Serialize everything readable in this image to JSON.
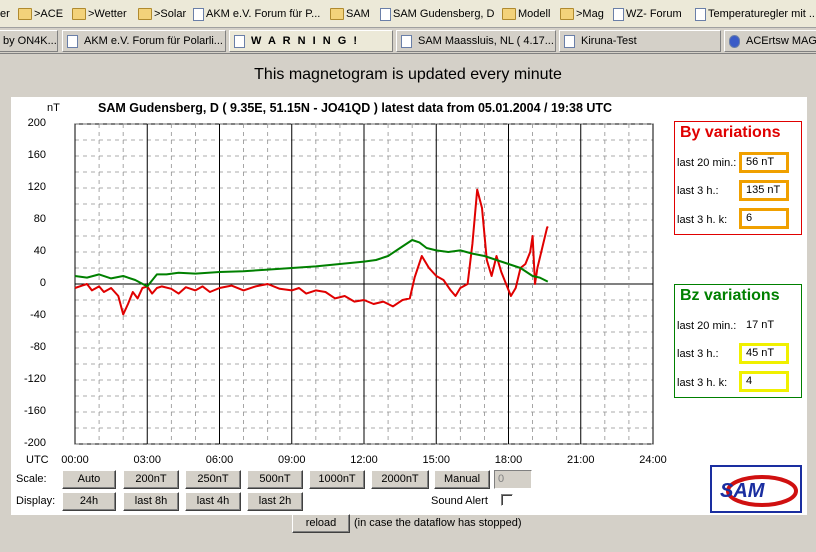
{
  "bookmarks": [
    {
      "label": "er",
      "icon": "none",
      "x": 0
    },
    {
      "label": ">ACE",
      "icon": "folder-icon",
      "x": 18
    },
    {
      "label": ">Wetter",
      "icon": "folder-icon",
      "x": 72
    },
    {
      "label": ">Solar",
      "icon": "folder-icon",
      "x": 138
    },
    {
      "label": "AKM e.V. Forum für P...",
      "icon": "page-icon",
      "x": 193
    },
    {
      "label": "SAM",
      "icon": "folder-icon",
      "x": 330
    },
    {
      "label": "SAM Gudensberg, D",
      "icon": "page-icon",
      "x": 380
    },
    {
      "label": "Modell",
      "icon": "folder-icon",
      "x": 502
    },
    {
      "label": ">Mag",
      "icon": "folder-icon",
      "x": 560
    },
    {
      "label": "WZ- Forum",
      "icon": "page-icon",
      "x": 613
    },
    {
      "label": "Temperaturegler mit ...",
      "icon": "page-icon",
      "x": 695
    }
  ],
  "tabs": [
    {
      "label": "by ON4K..."
    },
    {
      "label": "AKM e.V. Forum für Polarli..."
    },
    {
      "label": "W A R N I N G !"
    },
    {
      "label": "SAM Maassluis, NL ( 4.17..."
    },
    {
      "label": "Kiruna-Test"
    },
    {
      "label": "ACErtsw MAG"
    }
  ],
  "banner": "This magnetogram is updated every minute",
  "chart_data": {
    "type": "line",
    "title": "SAM Gudensberg, D  ( 9.35E, 51.15N - JO41QD )  latest data from 05.01.2004 / 19:38 UTC",
    "ylabel": "nT",
    "xlabel": "UTC",
    "ylim": [
      -200,
      200
    ],
    "xlim": [
      0,
      24
    ],
    "yticks": [
      "200",
      "160",
      "120",
      "80",
      "40",
      "0",
      "-40",
      "-80",
      "-120",
      "-160",
      "-200"
    ],
    "xticks": [
      "00:00",
      "03:00",
      "06:00",
      "09:00",
      "12:00",
      "15:00",
      "18:00",
      "21:00",
      "24:00"
    ],
    "grid": true,
    "series": [
      {
        "name": "By",
        "color": "#e00000",
        "points": [
          [
            0,
            -5
          ],
          [
            0.3,
            -2
          ],
          [
            0.5,
            0
          ],
          [
            0.7,
            -8
          ],
          [
            1,
            -3
          ],
          [
            1.2,
            -10
          ],
          [
            1.5,
            -5
          ],
          [
            1.8,
            -15
          ],
          [
            2,
            -38
          ],
          [
            2.2,
            -25
          ],
          [
            2.4,
            -10
          ],
          [
            2.6,
            -18
          ],
          [
            2.8,
            -5
          ],
          [
            3,
            -3
          ],
          [
            3.2,
            -12
          ],
          [
            3.4,
            -5
          ],
          [
            3.6,
            -3
          ],
          [
            4,
            -6
          ],
          [
            4.3,
            -12
          ],
          [
            4.6,
            -4
          ],
          [
            5,
            -8
          ],
          [
            5.3,
            -3
          ],
          [
            5.6,
            -10
          ],
          [
            6,
            -5
          ],
          [
            6.5,
            -2
          ],
          [
            7,
            -8
          ],
          [
            7.5,
            -3
          ],
          [
            8,
            0
          ],
          [
            8.5,
            -6
          ],
          [
            9,
            -8
          ],
          [
            9.3,
            -5
          ],
          [
            9.6,
            -12
          ],
          [
            10,
            -8
          ],
          [
            10.4,
            -10
          ],
          [
            10.8,
            -18
          ],
          [
            11.2,
            -15
          ],
          [
            11.6,
            -22
          ],
          [
            12,
            -20
          ],
          [
            12.4,
            -25
          ],
          [
            12.8,
            -22
          ],
          [
            13.2,
            -28
          ],
          [
            13.6,
            -20
          ],
          [
            13.9,
            -18
          ],
          [
            14.1,
            8
          ],
          [
            14.4,
            35
          ],
          [
            14.7,
            20
          ],
          [
            15,
            10
          ],
          [
            15.3,
            5
          ],
          [
            15.6,
            -8
          ],
          [
            15.8,
            -15
          ],
          [
            16.0,
            -5
          ],
          [
            16.3,
            0
          ],
          [
            16.5,
            50
          ],
          [
            16.7,
            118
          ],
          [
            16.9,
            95
          ],
          [
            17.1,
            30
          ],
          [
            17.3,
            10
          ],
          [
            17.5,
            35
          ],
          [
            17.7,
            15
          ],
          [
            17.9,
            0
          ],
          [
            18.1,
            -15
          ],
          [
            18.3,
            -5
          ],
          [
            18.5,
            20
          ],
          [
            18.7,
            25
          ],
          [
            18.9,
            40
          ],
          [
            19.0,
            60
          ],
          [
            19.1,
            0
          ],
          [
            19.2,
            20
          ],
          [
            19.4,
            45
          ],
          [
            19.6,
            70
          ],
          [
            19.63,
            72
          ]
        ]
      },
      {
        "name": "Bz",
        "color": "#008000",
        "points": [
          [
            0,
            10
          ],
          [
            0.5,
            8
          ],
          [
            1,
            12
          ],
          [
            1.5,
            7
          ],
          [
            2,
            10
          ],
          [
            2.5,
            5
          ],
          [
            3,
            -3
          ],
          [
            3.4,
            12
          ],
          [
            3.8,
            12
          ],
          [
            4.3,
            14
          ],
          [
            5,
            13
          ],
          [
            6,
            15
          ],
          [
            7,
            16
          ],
          [
            8,
            18
          ],
          [
            9,
            20
          ],
          [
            10,
            22
          ],
          [
            11,
            25
          ],
          [
            12,
            28
          ],
          [
            12.5,
            30
          ],
          [
            13,
            35
          ],
          [
            13.5,
            45
          ],
          [
            14,
            55
          ],
          [
            14.3,
            52
          ],
          [
            14.6,
            45
          ],
          [
            15,
            42
          ],
          [
            15.5,
            40
          ],
          [
            16,
            42
          ],
          [
            16.5,
            38
          ],
          [
            17,
            35
          ],
          [
            17.5,
            30
          ],
          [
            18,
            25
          ],
          [
            18.5,
            20
          ],
          [
            19,
            10
          ],
          [
            19.3,
            8
          ],
          [
            19.63,
            3
          ]
        ]
      }
    ]
  },
  "by_box": {
    "title": "By variations",
    "rows": [
      {
        "label": "last 20 min.:",
        "value": "56 nT"
      },
      {
        "label": "last 3 h.:",
        "value": "135 nT"
      },
      {
        "label": "last 3 h. k:",
        "value": "6"
      }
    ],
    "color": "#e00000",
    "value_border": "#f0a000"
  },
  "bz_box": {
    "title": "Bz variations",
    "rows": [
      {
        "label": "last 20 min.:",
        "value": "17 nT"
      },
      {
        "label": "last 3 h.:",
        "value": "45 nT"
      },
      {
        "label": "last 3 h. k:",
        "value": "4"
      }
    ],
    "color": "#008000",
    "value_border": "#f0f000"
  },
  "controls": {
    "scale_label": "Scale:",
    "scale_buttons": [
      "Auto",
      "200nT",
      "250nT",
      "500nT",
      "1000nT",
      "2000nT",
      "Manual"
    ],
    "manual_value": "0",
    "display_label": "Display:",
    "display_buttons": [
      "24h",
      "last 8h",
      "last 4h",
      "last 2h"
    ],
    "sound_alert_label": "Sound Alert",
    "sound_alert_checked": false,
    "reload_label": "reload",
    "reload_note": "(in case the dataflow has stopped)"
  },
  "logo_text": "SAM"
}
